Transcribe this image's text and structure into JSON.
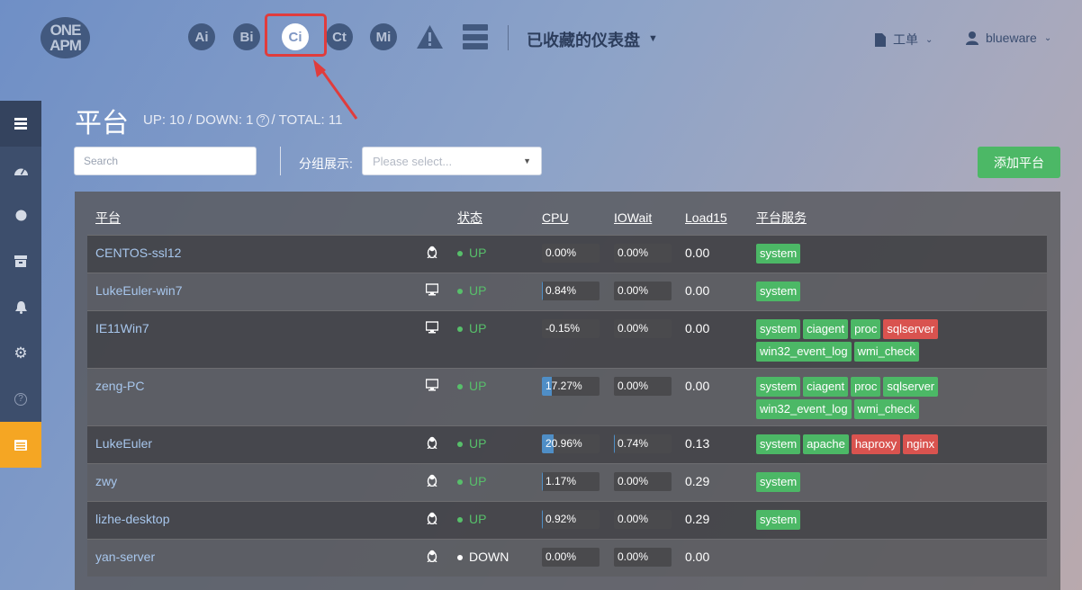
{
  "logo": {
    "line1": "ONE",
    "line2": "APM"
  },
  "products": [
    {
      "name": "ai",
      "label": "Ai"
    },
    {
      "name": "bi",
      "label": "Bi"
    },
    {
      "name": "ci",
      "label": "Ci"
    },
    {
      "name": "ct",
      "label": "Ct"
    },
    {
      "name": "mi",
      "label": "Mi"
    }
  ],
  "header": {
    "dashboard_label": "已收藏的仪表盘",
    "ticket_label": "工单",
    "user_label": "blueware"
  },
  "page": {
    "title": "平台",
    "stats_prefix": "UP: 10 / DOWN: 1",
    "stats_suffix": "/ TOTAL: 11",
    "help_glyph": "?"
  },
  "filters": {
    "search_placeholder": "Search",
    "group_label": "分组展示:",
    "group_placeholder": "Please select...",
    "add_button": "添加平台"
  },
  "table": {
    "headers": {
      "platform": "平台",
      "status": "状态",
      "cpu": "CPU",
      "iowait": "IOWait",
      "load15": "Load15",
      "services": "平台服务"
    },
    "rows": [
      {
        "name": "CENTOS-ssl12",
        "os": "linux",
        "status": "UP",
        "cpu": "0.00%",
        "cpu_pct": 0,
        "iowait": "0.00%",
        "iowait_pct": 0,
        "load": "0.00",
        "services": [
          {
            "label": "system",
            "color": "green"
          }
        ]
      },
      {
        "name": "LukeEuler-win7",
        "os": "windows",
        "status": "UP",
        "cpu": "0.84%",
        "cpu_pct": 0.84,
        "iowait": "0.00%",
        "iowait_pct": 0,
        "load": "0.00",
        "services": [
          {
            "label": "system",
            "color": "green"
          }
        ]
      },
      {
        "name": "IE11Win7",
        "os": "windows",
        "status": "UP",
        "cpu": "-0.15%",
        "cpu_pct": 0,
        "iowait": "0.00%",
        "iowait_pct": 0,
        "load": "0.00",
        "services": [
          {
            "label": "system",
            "color": "green"
          },
          {
            "label": "ciagent",
            "color": "green"
          },
          {
            "label": "proc",
            "color": "green"
          },
          {
            "label": "sqlserver",
            "color": "red"
          },
          {
            "label": "win32_event_log",
            "color": "green"
          },
          {
            "label": "wmi_check",
            "color": "green"
          }
        ]
      },
      {
        "name": "zeng-PC",
        "os": "windows",
        "status": "UP",
        "cpu": "17.27%",
        "cpu_pct": 17.27,
        "iowait": "0.00%",
        "iowait_pct": 0,
        "load": "0.00",
        "services": [
          {
            "label": "system",
            "color": "green"
          },
          {
            "label": "ciagent",
            "color": "green"
          },
          {
            "label": "proc",
            "color": "green"
          },
          {
            "label": "sqlserver",
            "color": "green"
          },
          {
            "label": "win32_event_log",
            "color": "green"
          },
          {
            "label": "wmi_check",
            "color": "green"
          }
        ]
      },
      {
        "name": "LukeEuler",
        "os": "linux",
        "status": "UP",
        "cpu": "20.96%",
        "cpu_pct": 20.96,
        "iowait": "0.74%",
        "iowait_pct": 0.74,
        "load": "0.13",
        "services": [
          {
            "label": "system",
            "color": "green"
          },
          {
            "label": "apache",
            "color": "green"
          },
          {
            "label": "haproxy",
            "color": "red"
          },
          {
            "label": "nginx",
            "color": "red"
          }
        ]
      },
      {
        "name": "zwy",
        "os": "linux",
        "status": "UP",
        "cpu": "1.17%",
        "cpu_pct": 1.17,
        "iowait": "0.00%",
        "iowait_pct": 0,
        "load": "0.29",
        "services": [
          {
            "label": "system",
            "color": "green"
          }
        ]
      },
      {
        "name": "lizhe-desktop",
        "os": "linux",
        "status": "UP",
        "cpu": "0.92%",
        "cpu_pct": 0.92,
        "iowait": "0.00%",
        "iowait_pct": 0,
        "load": "0.29",
        "services": [
          {
            "label": "system",
            "color": "green"
          }
        ]
      },
      {
        "name": "yan-server",
        "os": "linux",
        "status": "DOWN",
        "cpu": "0.00%",
        "cpu_pct": 0,
        "iowait": "0.00%",
        "iowait_pct": 0,
        "load": "0.00",
        "services": []
      }
    ]
  },
  "sidebar": {
    "items": [
      {
        "icon": "server-list-icon",
        "active": false
      },
      {
        "icon": "dashboard-gauge-icon",
        "active": false
      },
      {
        "icon": "circle-icon",
        "active": false
      },
      {
        "icon": "archive-icon",
        "active": false
      },
      {
        "icon": "bell-icon",
        "active": false
      },
      {
        "icon": "gear-icon",
        "active": false
      },
      {
        "icon": "help-icon",
        "active": false
      },
      {
        "icon": "platform-list-icon",
        "active": true
      }
    ]
  },
  "colors": {
    "accent_green": "#4cb866",
    "alert_red": "#d9534f",
    "highlight": "#e03c3c",
    "sidebar_active": "#f5a623"
  }
}
